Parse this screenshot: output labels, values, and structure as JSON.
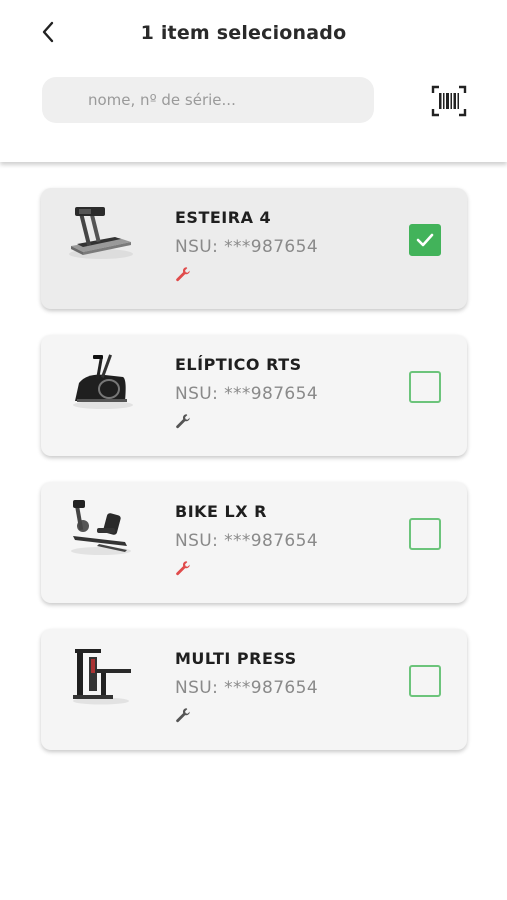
{
  "header": {
    "title": "1 item selecionado",
    "search_placeholder": "nome, nº de série..."
  },
  "colors": {
    "accent_green": "#42b35a",
    "alert_red": "#e04b4b",
    "neutral_icon": "#555555"
  },
  "items": [
    {
      "name": "ESTEIRA 4",
      "nsu": "NSU: ***987654",
      "maintenance_status": "alert",
      "selected": true,
      "icon": "treadmill-icon"
    },
    {
      "name": "ELÍPTICO RTS",
      "nsu": "NSU: ***987654",
      "maintenance_status": "normal",
      "selected": false,
      "icon": "elliptical-icon"
    },
    {
      "name": "BIKE LX R",
      "nsu": "NSU: ***987654",
      "maintenance_status": "alert",
      "selected": false,
      "icon": "recumbent-bike-icon"
    },
    {
      "name": "MULTI PRESS",
      "nsu": "NSU: ***987654",
      "maintenance_status": "normal",
      "selected": false,
      "icon": "multi-press-icon"
    }
  ]
}
